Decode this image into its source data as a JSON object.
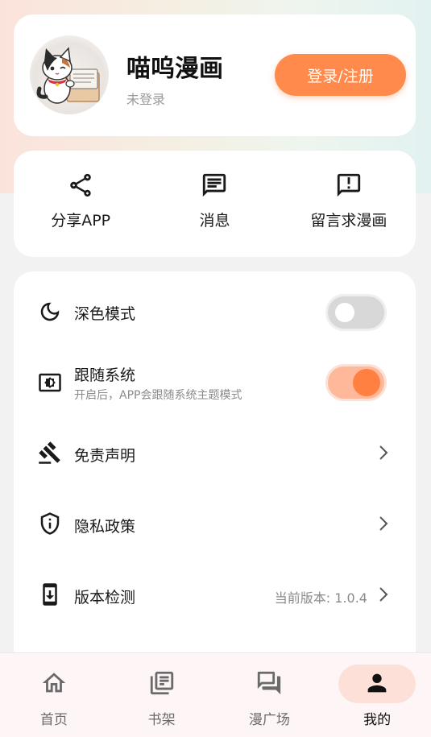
{
  "profile": {
    "app_name": "喵呜漫画",
    "status": "未登录",
    "login_label": "登录/注册"
  },
  "actions": [
    {
      "label": "分享APP",
      "icon": "share-icon"
    },
    {
      "label": "消息",
      "icon": "message-icon"
    },
    {
      "label": "留言求漫画",
      "icon": "feedback-icon"
    }
  ],
  "settings": {
    "dark_mode": {
      "label": "深色模式",
      "icon": "moon-icon",
      "enabled": false
    },
    "follow_system": {
      "label": "跟随系统",
      "desc": "开启后，APP会跟随系统主题模式",
      "icon": "brightness-icon",
      "enabled": true
    },
    "disclaimer": {
      "label": "免责声明",
      "icon": "gavel-icon"
    },
    "privacy": {
      "label": "隐私政策",
      "icon": "shield-info-icon"
    },
    "version": {
      "label": "版本检测",
      "icon": "phone-download-icon",
      "value": "当前版本: 1.0.4"
    }
  },
  "nav": [
    {
      "label": "首页",
      "icon": "home-icon"
    },
    {
      "label": "书架",
      "icon": "library-icon"
    },
    {
      "label": "漫广场",
      "icon": "forum-icon"
    },
    {
      "label": "我的",
      "icon": "person-icon",
      "active": true
    }
  ],
  "colors": {
    "accent": "#ff8a4c",
    "toggle_on_track": "#ffb899",
    "toggle_off_track": "#d8d8d8",
    "active_nav_bg": "#fde1d9"
  }
}
